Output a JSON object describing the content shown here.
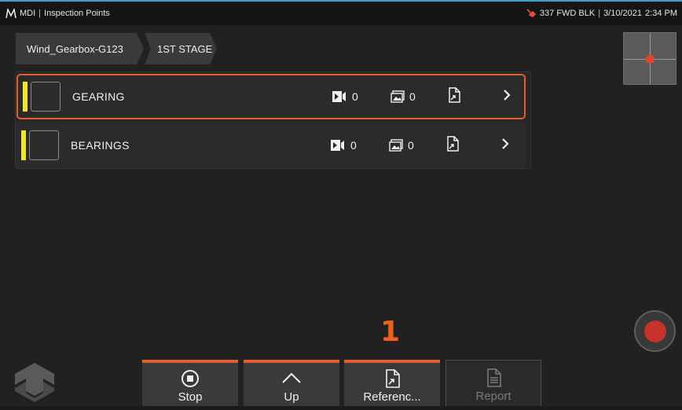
{
  "status_bar": {
    "app_name": "MDI",
    "separator": "|",
    "screen_title": "Inspection Points",
    "probe_label": "337 FWD BLK",
    "date": "3/10/2021",
    "time": "2:34 PM"
  },
  "breadcrumb": {
    "items": [
      "Wind_Gearbox-G123",
      "1ST STAGE"
    ]
  },
  "inspection_points": [
    {
      "name": "GEARING",
      "video_count": "0",
      "image_count": "0",
      "selected": true,
      "status_color": "#f2e62b"
    },
    {
      "name": "BEARINGS",
      "video_count": "0",
      "image_count": "0",
      "selected": false,
      "status_color": "#f2e62b"
    }
  ],
  "callout_number": "1",
  "softkeys": [
    {
      "label": "Stop",
      "icon": "stop-icon",
      "enabled": true
    },
    {
      "label": "Up",
      "icon": "chevron-up-icon",
      "enabled": true
    },
    {
      "label": "Referenc...",
      "icon": "reference-document-icon",
      "enabled": true
    },
    {
      "label": "Report",
      "icon": "report-document-icon",
      "enabled": false
    }
  ],
  "colors": {
    "accent": "#e35d2e",
    "status_yellow": "#f2e62b",
    "record_red": "#c5322a",
    "callout_orange": "#e8601c"
  }
}
